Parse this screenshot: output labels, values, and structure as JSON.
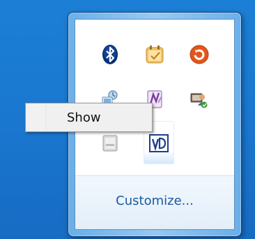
{
  "tray": {
    "icons": [
      {
        "name": "bluetooth-icon",
        "color": "#0a3a8a"
      },
      {
        "name": "calendar-reminder-icon",
        "color": "#e7b24a"
      },
      {
        "name": "orange-refresh-icon",
        "color": "#e2561b"
      },
      {
        "name": "network-computer-icon",
        "color": "#5b7fa8"
      },
      {
        "name": "onenote-clip-icon",
        "color": "#7a3e9d"
      },
      {
        "name": "user-network-icon",
        "color": "#3a9a3a"
      },
      {
        "name": "generic-app-icon",
        "color": "#bfbfbf"
      },
      {
        "name": "visio-icon",
        "color": "#1f3e8a"
      }
    ],
    "customize_label": "Customize..."
  },
  "context_menu": {
    "show_label": "Show"
  }
}
